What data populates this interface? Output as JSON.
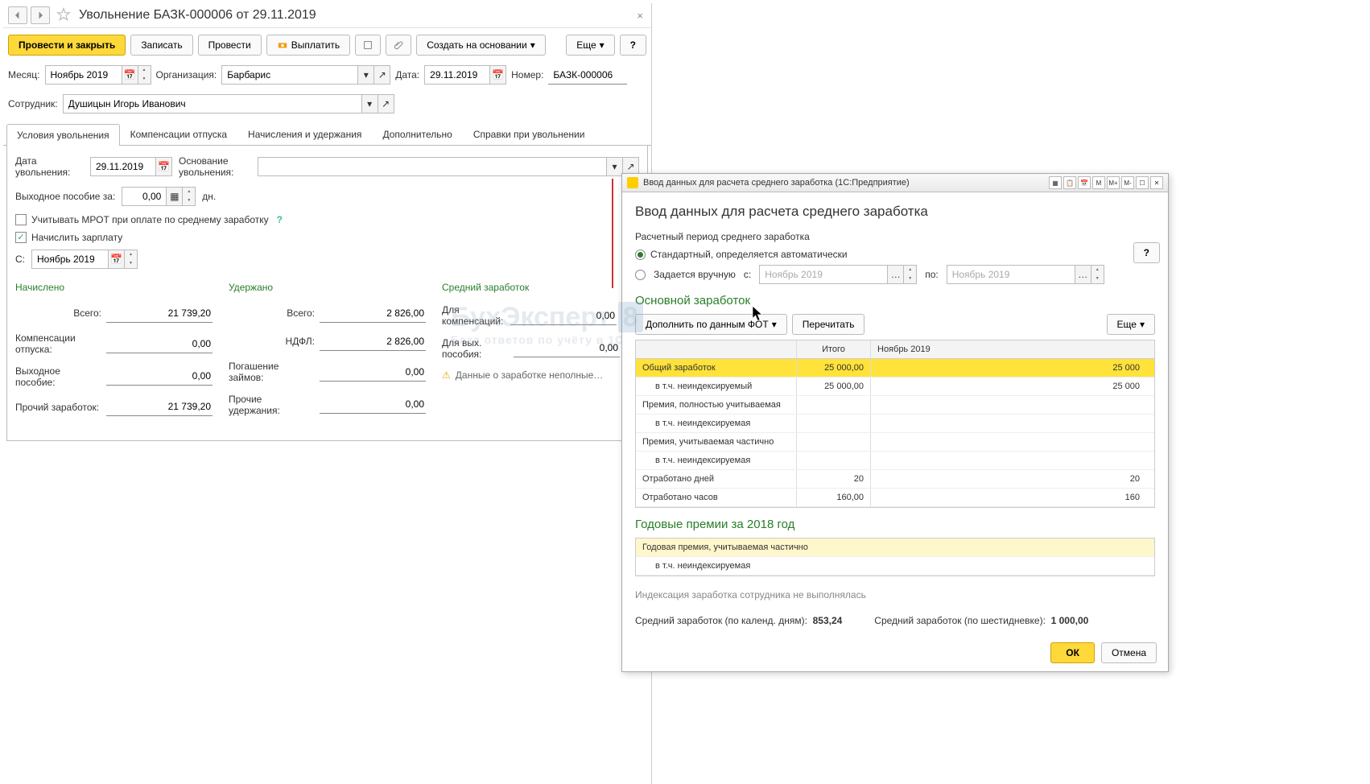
{
  "main": {
    "title": "Увольнение БАЗК-000006 от 29.11.2019",
    "toolbar": {
      "post_close": "Провести и закрыть",
      "write": "Записать",
      "post": "Провести",
      "pay": "Выплатить",
      "create_based": "Создать на основании",
      "more": "Еще",
      "help": "?"
    },
    "filters": {
      "month_lbl": "Месяц:",
      "month": "Ноябрь 2019",
      "org_lbl": "Организация:",
      "org": "Барбарис",
      "date_lbl": "Дата:",
      "date": "29.11.2019",
      "number_lbl": "Номер:",
      "number": "БАЗК-000006",
      "employee_lbl": "Сотрудник:",
      "employee": "Душицын Игорь Иванович"
    },
    "tabs": [
      "Условия увольнения",
      "Компенсации отпуска",
      "Начисления и удержания",
      "Дополнительно",
      "Справки при увольнении"
    ],
    "conditions": {
      "fire_date_lbl": "Дата\nувольнения:",
      "fire_date": "29.11.2019",
      "basis_lbl": "Основание\nувольнения:",
      "severance_lbl": "Выходное пособие за:",
      "severance_amt": "0,00",
      "severance_unit": "дн.",
      "mrot_chk": "Учитывать МРОТ при оплате по среднему заработку",
      "mrot_q": "?",
      "accr_chk": "Начислить зарплату",
      "from_lbl": "С:",
      "from_month": "Ноябрь 2019"
    },
    "summary": {
      "col1_title": "Начислено",
      "total_lbl": "Всего:",
      "total": "21 739,20",
      "comp_lbl": "Компенсации\nотпуска:",
      "comp": "0,00",
      "sever_lbl": "Выходное\nпособие:",
      "sever": "0,00",
      "other_lbl": "Прочий заработок:",
      "other": "21 739,20",
      "col2_title": "Удержано",
      "held_total_lbl": "Всего:",
      "held_total": "2 826,00",
      "ndfl_lbl": "НДФЛ:",
      "ndfl": "2 826,00",
      "loan_lbl": "Погашение\nзаймов:",
      "loan": "0,00",
      "other_held_lbl": "Прочие\nудержания:",
      "other_held": "0,00",
      "col3_title": "Средний заработок",
      "for_comp_lbl": "Для\nкомпенсаций:",
      "for_comp": "0,00",
      "for_sever_lbl": "Для вых.\nпособия:",
      "for_sever": "0,00",
      "warn": "Данные о заработке неполные…"
    }
  },
  "modal": {
    "titlebar": "Ввод данных для расчета среднего заработка  (1С:Предприятие)",
    "title": "Ввод данных для расчета среднего заработка",
    "period_lbl": "Расчетный период среднего заработка",
    "mode_std": "Стандартный, определяется автоматически",
    "mode_manual": "Задается вручную",
    "from_lbl": "с:",
    "from": "Ноябрь 2019",
    "to_lbl": "по:",
    "to": "Ноябрь 2019",
    "help": "?",
    "section_earn": "Основной заработок",
    "tb": {
      "fill_fot": "Дополнить по данным ФОТ",
      "reread": "Перечитать",
      "more": "Еще"
    },
    "table": {
      "head": [
        "",
        "Итого",
        "Ноябрь 2019"
      ],
      "rows": [
        {
          "label": "Общий заработок",
          "v1": "25 000,00",
          "v2": "25 000",
          "hl": true,
          "indent": false
        },
        {
          "label": "в т.ч. неиндексируемый",
          "v1": "25 000,00",
          "v2": "25 000",
          "hl": false,
          "indent": true
        },
        {
          "label": "Премия, полностью учитываемая",
          "v1": "",
          "v2": "",
          "hl": false,
          "indent": false
        },
        {
          "label": "в т.ч. неиндексируемая",
          "v1": "",
          "v2": "",
          "hl": false,
          "indent": true
        },
        {
          "label": "Премия, учитываемая частично",
          "v1": "",
          "v2": "",
          "hl": false,
          "indent": false
        },
        {
          "label": "в т.ч. неиндексируемая",
          "v1": "",
          "v2": "",
          "hl": false,
          "indent": true
        },
        {
          "label": "Отработано дней",
          "v1": "20",
          "v2": "20",
          "hl": false,
          "indent": false
        },
        {
          "label": "Отработано часов",
          "v1": "160,00",
          "v2": "160",
          "hl": false,
          "indent": false
        }
      ]
    },
    "section_bonus": "Годовые премии за 2018 год",
    "bonus_table": {
      "rows": [
        {
          "label": "Годовая премия, учитываемая частично",
          "hl": true,
          "indent": false
        },
        {
          "label": "в т.ч. неиндексируемая",
          "hl": false,
          "indent": true
        }
      ]
    },
    "index_note": "Индексация заработка сотрудника не выполнялась",
    "avg_cal_lbl": "Средний заработок (по календ. дням):",
    "avg_cal": "853,24",
    "avg_six_lbl": "Средний заработок (по шестидневке):",
    "avg_six": "1 000,00",
    "ok": "ОК",
    "cancel": "Отмена",
    "wb": [
      "M",
      "M+",
      "M-",
      "☐",
      "✕"
    ]
  },
  "watermark": {
    "main": "БухЭксперт",
    "sub": "База ответов по учёту в 1С",
    "badge": "8"
  }
}
